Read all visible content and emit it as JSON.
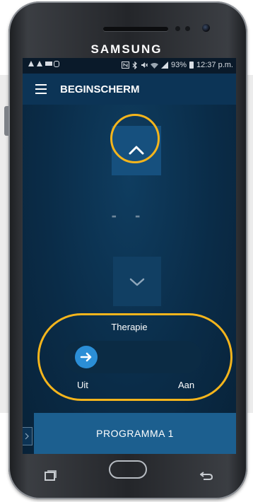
{
  "device": {
    "brand": "SAMSUNG"
  },
  "statusbar": {
    "icons_left": [
      "warning-icon",
      "warning-icon",
      "video-icon",
      "sync-icon"
    ],
    "icons_right": [
      "nfc-icon",
      "bluetooth-icon",
      "mute-icon",
      "wifi-icon",
      "signal-icon"
    ],
    "battery": "93%",
    "time": "12:37 p.m."
  },
  "toolbar": {
    "title": "BEGINSCHERM",
    "menu_icon": "menu-icon"
  },
  "control": {
    "up_icon": "chevron-up-icon",
    "down_icon": "chevron-down-icon",
    "value": "- -"
  },
  "therapy": {
    "label": "Therapie",
    "off_label": "Uit",
    "on_label": "Aan",
    "state": "off"
  },
  "program": {
    "label": "PROGRAMMA 1"
  },
  "navbar": {
    "recent_icon": "recent-apps-icon",
    "home_icon": "home-icon",
    "back_icon": "back-icon"
  },
  "colors": {
    "highlight": "#f5b51c",
    "toggle_knob": "#2b8ed6",
    "screen_bg": "#0a2c48"
  }
}
